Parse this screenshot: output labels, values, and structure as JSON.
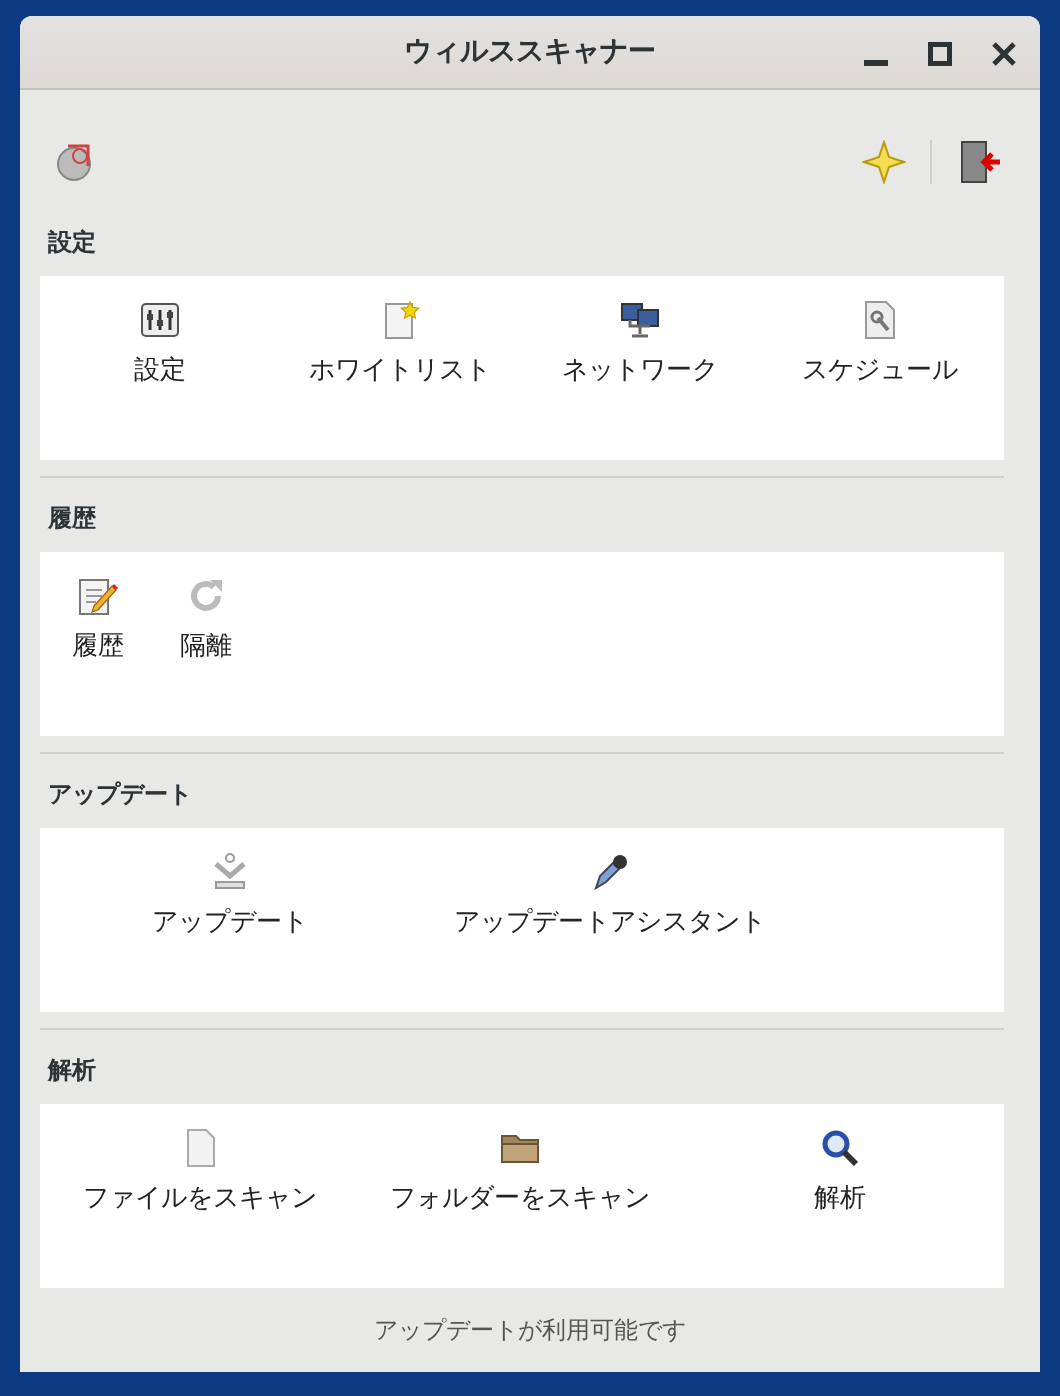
{
  "window": {
    "title": "ウィルススキャナー"
  },
  "sections": [
    {
      "title": "設定",
      "items": [
        {
          "label": "設定"
        },
        {
          "label": "ホワイトリスト"
        },
        {
          "label": "ネットワーク"
        },
        {
          "label": "スケジュール"
        }
      ]
    },
    {
      "title": "履歴",
      "items": [
        {
          "label": "履歴"
        },
        {
          "label": "隔離"
        }
      ]
    },
    {
      "title": "アップデート",
      "items": [
        {
          "label": "アップデート"
        },
        {
          "label": "アップデートアシスタント"
        }
      ]
    },
    {
      "title": "解析",
      "items": [
        {
          "label": "ファイルをスキャン"
        },
        {
          "label": "フォルダーをスキャン"
        },
        {
          "label": "解析"
        }
      ]
    }
  ],
  "status_bar": "アップデートが利用可能です"
}
